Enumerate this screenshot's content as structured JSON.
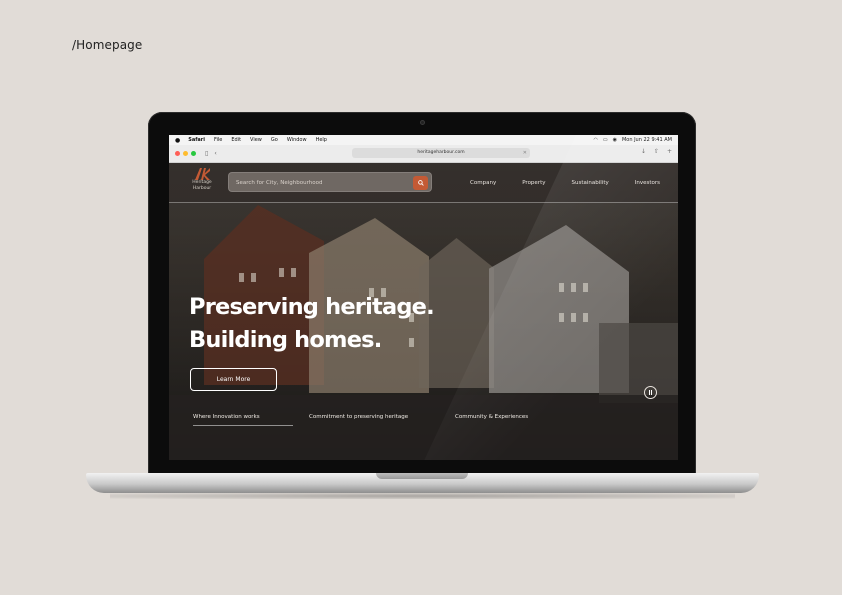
{
  "page_label": "/Homepage",
  "menubar": {
    "apple": "",
    "items": [
      "Safari",
      "File",
      "Edit",
      "View",
      "Go",
      "Window",
      "Help"
    ],
    "datetime": "Mon Jun 22  9:41 AM"
  },
  "browser": {
    "url": "heritageharbour.com"
  },
  "site": {
    "logo_line1": "Heritage",
    "logo_line2": "Harbour",
    "search_placeholder": "Search for City, Neighbourhood",
    "nav": [
      "Company",
      "Property",
      "Sustainability",
      "Investors"
    ],
    "hero_line1": "Preserving heritage.",
    "hero_line2": "Building homes.",
    "cta": "Learn More",
    "tabs": [
      "Where Innovation works",
      "Commitment to preserving heritage",
      "Community & Experiences"
    ]
  },
  "colors": {
    "page_background": "#e1dcd7",
    "accent": "#c45a35",
    "text_light": "#ffffff"
  },
  "icons": {
    "search": "search-icon",
    "pause": "pause-icon"
  }
}
